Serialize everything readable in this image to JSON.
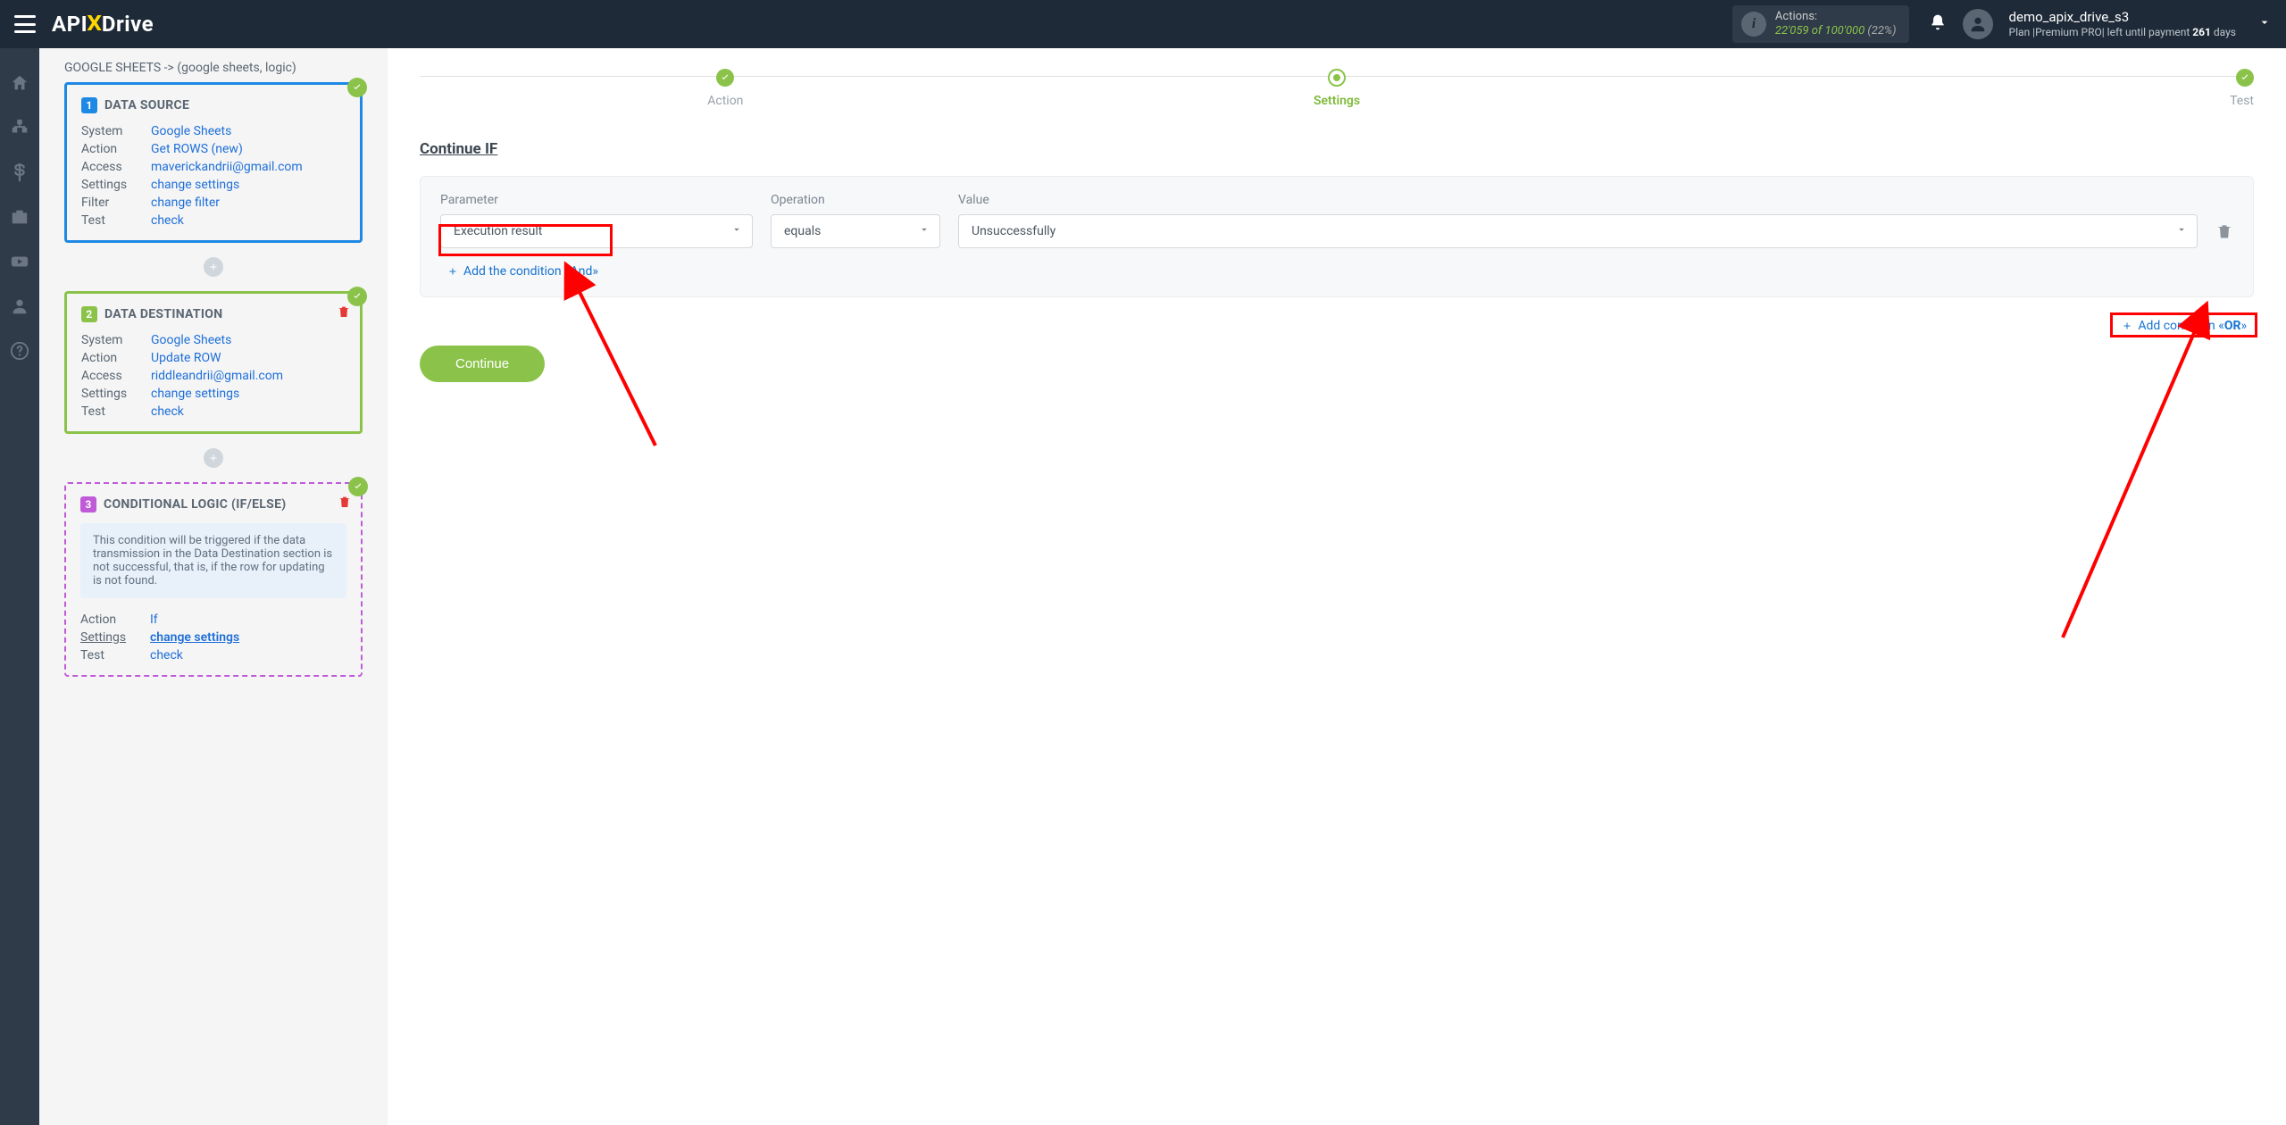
{
  "header": {
    "logo_pre": "API",
    "logo_x": "X",
    "logo_post": "Drive",
    "actions_title": "Actions:",
    "actions_used": "22'059",
    "actions_of": " of ",
    "actions_total": "100'000",
    "actions_pct": " (22%)",
    "user_name": "demo_apix_drive_s3",
    "user_plan_prefix": "Plan |Premium PRO| left until payment ",
    "user_plan_days": "261",
    "user_plan_suffix": " days"
  },
  "breadcrumb": "GOOGLE SHEETS -> (google sheets, logic)",
  "cards": {
    "source": {
      "num": "1",
      "title": "DATA SOURCE",
      "rows": {
        "system_k": "System",
        "system_v": "Google Sheets",
        "action_k": "Action",
        "action_v": "Get ROWS (new)",
        "access_k": "Access",
        "access_v": "maverickandrii@gmail.com",
        "settings_k": "Settings",
        "settings_v": "change settings",
        "filter_k": "Filter",
        "filter_v": "change filter",
        "test_k": "Test",
        "test_v": "check"
      }
    },
    "dest": {
      "num": "2",
      "title": "DATA DESTINATION",
      "rows": {
        "system_k": "System",
        "system_v": "Google Sheets",
        "action_k": "Action",
        "action_v": "Update ROW",
        "access_k": "Access",
        "access_v": "riddleandrii@gmail.com",
        "settings_k": "Settings",
        "settings_v": "change settings",
        "test_k": "Test",
        "test_v": "check"
      }
    },
    "logic": {
      "num": "3",
      "title": "CONDITIONAL LOGIC (IF/ELSE)",
      "note": "This condition will be triggered if the data transmission in the Data Destination section is not successful, that is, if the row for updating is not found.",
      "rows": {
        "action_k": "Action",
        "action_v": "If",
        "settings_k": "Settings",
        "settings_v": "change settings",
        "test_k": "Test",
        "test_v": "check"
      }
    }
  },
  "steps": {
    "action": "Action",
    "settings": "Settings",
    "test": "Test"
  },
  "filter": {
    "heading": "Continue IF",
    "labels": {
      "param": "Parameter",
      "op": "Operation",
      "val": "Value"
    },
    "values": {
      "param": "Execution result",
      "op": "equals",
      "val": "Unsuccessfully"
    },
    "add_and": "Add the condition «And»",
    "add_or_prefix": "Add condition «",
    "add_or_bold": "OR",
    "add_or_suffix": "»"
  },
  "buttons": {
    "continue": "Continue"
  }
}
